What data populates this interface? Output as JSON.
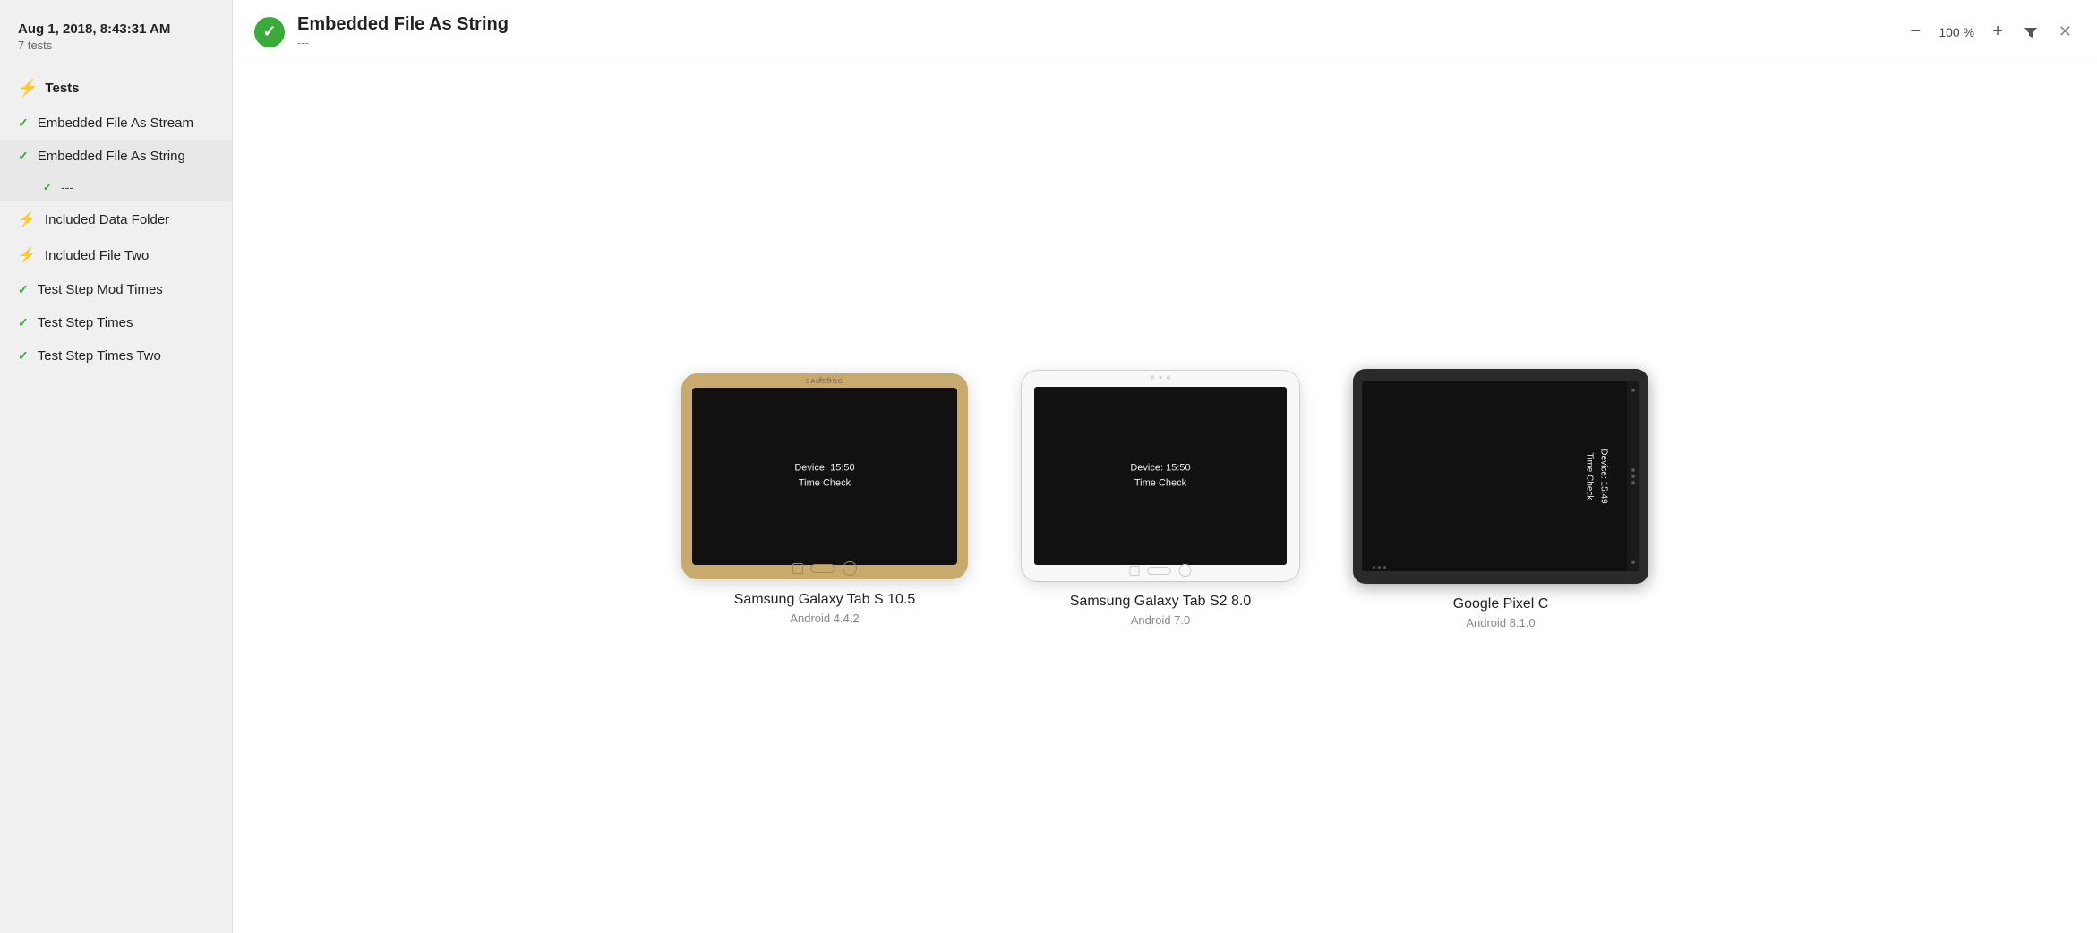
{
  "sidebar": {
    "date": "Aug 1, 2018, 8:43:31 AM",
    "count": "7 tests",
    "section_label": "Tests",
    "items": [
      {
        "id": "embedded-file-stream",
        "label": "Embedded File As Stream",
        "status": "pass",
        "icon": "check"
      },
      {
        "id": "embedded-file-string",
        "label": "Embedded File As String",
        "status": "pass",
        "icon": "check",
        "active": true,
        "subitems": [
          {
            "id": "dashes",
            "label": "---",
            "status": "pass",
            "icon": "check",
            "active": true
          }
        ]
      },
      {
        "id": "included-data-folder",
        "label": "Included Data Folder",
        "status": "fail",
        "icon": "lightning"
      },
      {
        "id": "included-file-two",
        "label": "Included File Two",
        "status": "fail",
        "icon": "lightning"
      },
      {
        "id": "test-step-mod-times",
        "label": "Test Step Mod Times",
        "status": "pass",
        "icon": "check"
      },
      {
        "id": "test-step-times",
        "label": "Test Step Times",
        "status": "pass",
        "icon": "check"
      },
      {
        "id": "test-step-times-two",
        "label": "Test Step Times Two",
        "status": "pass",
        "icon": "check"
      }
    ]
  },
  "header": {
    "title": "Embedded File As String",
    "subtitle": "---",
    "status": "pass",
    "zoom": "100 %",
    "zoom_label": "100 %"
  },
  "devices": [
    {
      "id": "samsung-tab-s105",
      "name": "Samsung Galaxy Tab S 10.5",
      "os": "Android 4.4.2",
      "type": "tab-s105",
      "screen_text": "Device: 15:50\nTime Check"
    },
    {
      "id": "samsung-tab-s28",
      "name": "Samsung Galaxy Tab S2 8.0",
      "os": "Android 7.0",
      "type": "tab-s28",
      "screen_text": "Device: 15:50\nTime Check"
    },
    {
      "id": "google-pixel-c",
      "name": "Google Pixel C",
      "os": "Android 8.1.0",
      "type": "pixel-c",
      "screen_text": "Device: 15:49\nTime Check"
    }
  ],
  "icons": {
    "minus": "−",
    "plus": "+",
    "filter": "▼",
    "close": "✕",
    "check": "✓",
    "lightning": "⚡"
  }
}
